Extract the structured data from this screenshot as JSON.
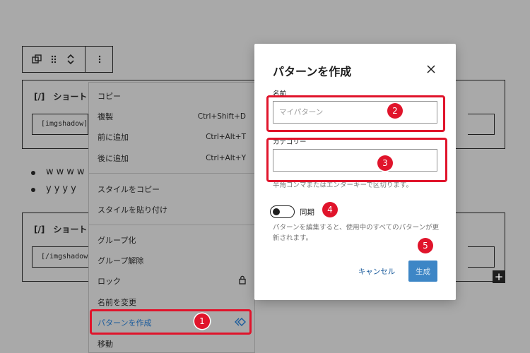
{
  "editor": {
    "block1": {
      "title": "ショートコ",
      "shortcode": "[imgshadow]"
    },
    "block2": {
      "title": "ショートコ",
      "shortcode": "[/imgshadow]"
    },
    "bullets": [
      "wwww",
      "yyyy"
    ],
    "add_block": "+"
  },
  "context_menu": {
    "items": [
      {
        "label": "コピー",
        "shortcut": ""
      },
      {
        "label": "複製",
        "shortcut": "Ctrl+Shift+D"
      },
      {
        "label": "前に追加",
        "shortcut": "Ctrl+Alt+T"
      },
      {
        "label": "後に追加",
        "shortcut": "Ctrl+Alt+Y"
      },
      {
        "label": "スタイルをコピー",
        "shortcut": ""
      },
      {
        "label": "スタイルを貼り付け",
        "shortcut": ""
      },
      {
        "label": "グループ化",
        "shortcut": ""
      },
      {
        "label": "グループ解除",
        "shortcut": ""
      },
      {
        "label": "ロック",
        "shortcut": ""
      },
      {
        "label": "名前を変更",
        "shortcut": ""
      },
      {
        "label": "パターンを作成",
        "shortcut": ""
      },
      {
        "label": "移動",
        "shortcut": ""
      }
    ]
  },
  "dialog": {
    "title": "パターンを作成",
    "name_label": "名前",
    "name_placeholder": "マイパターン",
    "category_label": "カテゴリー",
    "category_help": "半角コンマまたはエンターキーで区切ります。",
    "sync_label": "同期",
    "sync_help": "パターンを編集すると、使用中のすべてのパターンが更新されます。",
    "cancel_label": "キャンセル",
    "create_label": "生成"
  },
  "annotations": [
    "1",
    "2",
    "3",
    "4",
    "5"
  ],
  "colors": {
    "annotation": "#e0142b",
    "primary": "#3d86c6",
    "overlay": "#a9a9a9"
  }
}
